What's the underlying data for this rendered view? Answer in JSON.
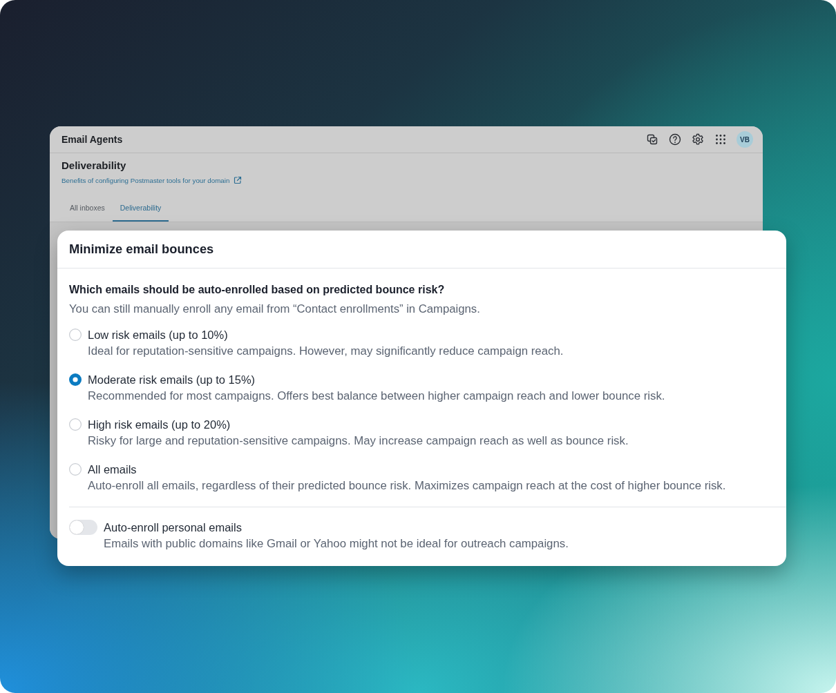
{
  "app_window": {
    "title": "Email Agents",
    "avatar": "VB",
    "page_title": "Deliverability",
    "help_link": "Benefits of configuring Postmaster tools for your domain",
    "tabs": [
      {
        "label": "All inboxes",
        "selected": false
      },
      {
        "label": "Deliverability",
        "selected": true
      }
    ]
  },
  "dialog": {
    "title": "Minimize email bounces",
    "question": "Which emails should be auto-enrolled based on predicted bounce risk?",
    "hint": "You can still manually enroll any email from “Contact enrollments” in Campaigns.",
    "options": [
      {
        "label": "Low risk emails (up to 10%)",
        "description": "Ideal for reputation-sensitive campaigns. However, may significantly reduce campaign reach.",
        "selected": false
      },
      {
        "label": "Moderate risk emails (up to 15%)",
        "description": "Recommended for most campaigns. Offers best balance between higher campaign reach and lower bounce risk.",
        "selected": true
      },
      {
        "label": "High risk emails (up to 20%)",
        "description": "Risky for large and reputation-sensitive campaigns. May increase campaign reach as well as bounce risk.",
        "selected": false
      },
      {
        "label": "All emails",
        "description": "Auto-enroll all emails, regardless of their predicted bounce risk. Maximizes campaign reach at the cost of higher bounce risk.",
        "selected": false
      }
    ],
    "toggle": {
      "label": "Auto-enroll personal emails",
      "description": "Emails with public domains like Gmail or Yahoo might not be ideal for outreach campaigns.",
      "on": false
    }
  }
}
